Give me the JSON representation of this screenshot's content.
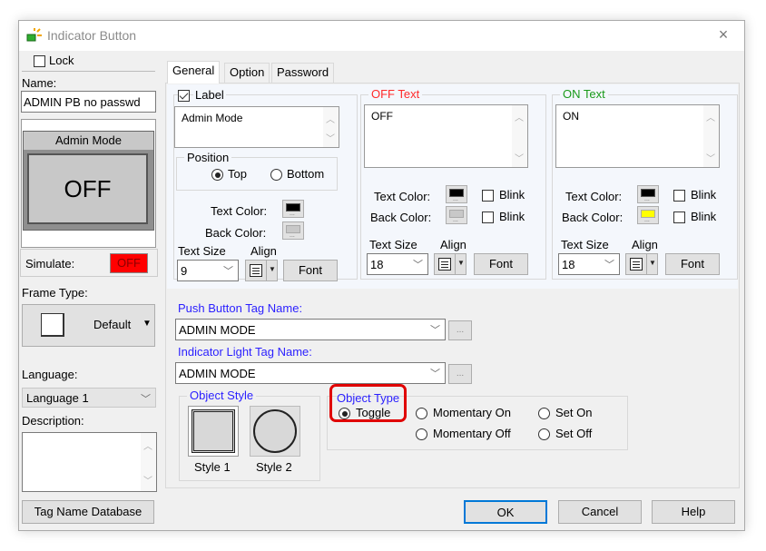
{
  "window": {
    "title": "Indicator Button",
    "close_label": "×"
  },
  "left": {
    "lock_label": "Lock",
    "lock_checked": false,
    "name_label": "Name:",
    "name_value": "ADMIN PB no passwd",
    "preview": {
      "label": "Admin Mode",
      "state_text": "OFF"
    },
    "simulate_label": "Simulate:",
    "simulate_value": "OFF",
    "simulate_color": "#ff0000",
    "frame_type_label": "Frame Type:",
    "frame_type_value": "Default",
    "language_label": "Language:",
    "language_value": "Language 1",
    "description_label": "Description:",
    "description_value": "",
    "tag_db_button": "Tag Name Database"
  },
  "tabs": [
    {
      "label": "General",
      "active": true
    },
    {
      "label": "Option",
      "active": false
    },
    {
      "label": "Password",
      "active": false
    }
  ],
  "general": {
    "label_group": {
      "title": "Label",
      "checked": true,
      "text": "Admin Mode",
      "position_title": "Position",
      "position_options": [
        "Top",
        "Bottom"
      ],
      "position_selected": "Top",
      "text_color_label": "Text Color:",
      "text_color": "#000000",
      "back_color_label": "Back Color:",
      "back_color": "#c8c8c8",
      "text_size_label": "Text Size",
      "text_size": "9",
      "align_label": "Align",
      "font_button": "Font"
    },
    "off_group": {
      "title": "OFF Text",
      "title_color": "#ff2a2a",
      "text": "OFF",
      "text_color_label": "Text Color:",
      "text_color": "#000000",
      "back_color_label": "Back Color:",
      "back_color": "#c8c8c8",
      "blink_label": "Blink",
      "text_blink": false,
      "back_blink": false,
      "text_size_label": "Text Size",
      "text_size": "18",
      "align_label": "Align",
      "font_button": "Font"
    },
    "on_group": {
      "title": "ON Text",
      "title_color": "#1a9a1a",
      "text": "ON",
      "text_color_label": "Text Color:",
      "text_color": "#000000",
      "back_color_label": "Back Color:",
      "back_color": "#ffff00",
      "blink_label": "Blink",
      "text_blink": false,
      "back_blink": false,
      "text_size_label": "Text Size",
      "text_size": "18",
      "align_label": "Align",
      "font_button": "Font"
    },
    "push_tag_label": "Push Button Tag Name:",
    "push_tag_value": "ADMIN MODE",
    "indicator_tag_label": "Indicator Light Tag Name:",
    "indicator_tag_value": "ADMIN MODE",
    "browse_label": "...",
    "object_style": {
      "title": "Object Style",
      "styles": [
        "Style 1",
        "Style 2"
      ],
      "selected": "Style 1"
    },
    "object_type": {
      "title": "Object Type",
      "options": [
        "Toggle",
        "Momentary On",
        "Momentary Off",
        "Set On",
        "Set Off"
      ],
      "selected": "Toggle",
      "highlight_color": "#e00000"
    }
  },
  "footer": {
    "ok": "OK",
    "cancel": "Cancel",
    "help": "Help"
  }
}
